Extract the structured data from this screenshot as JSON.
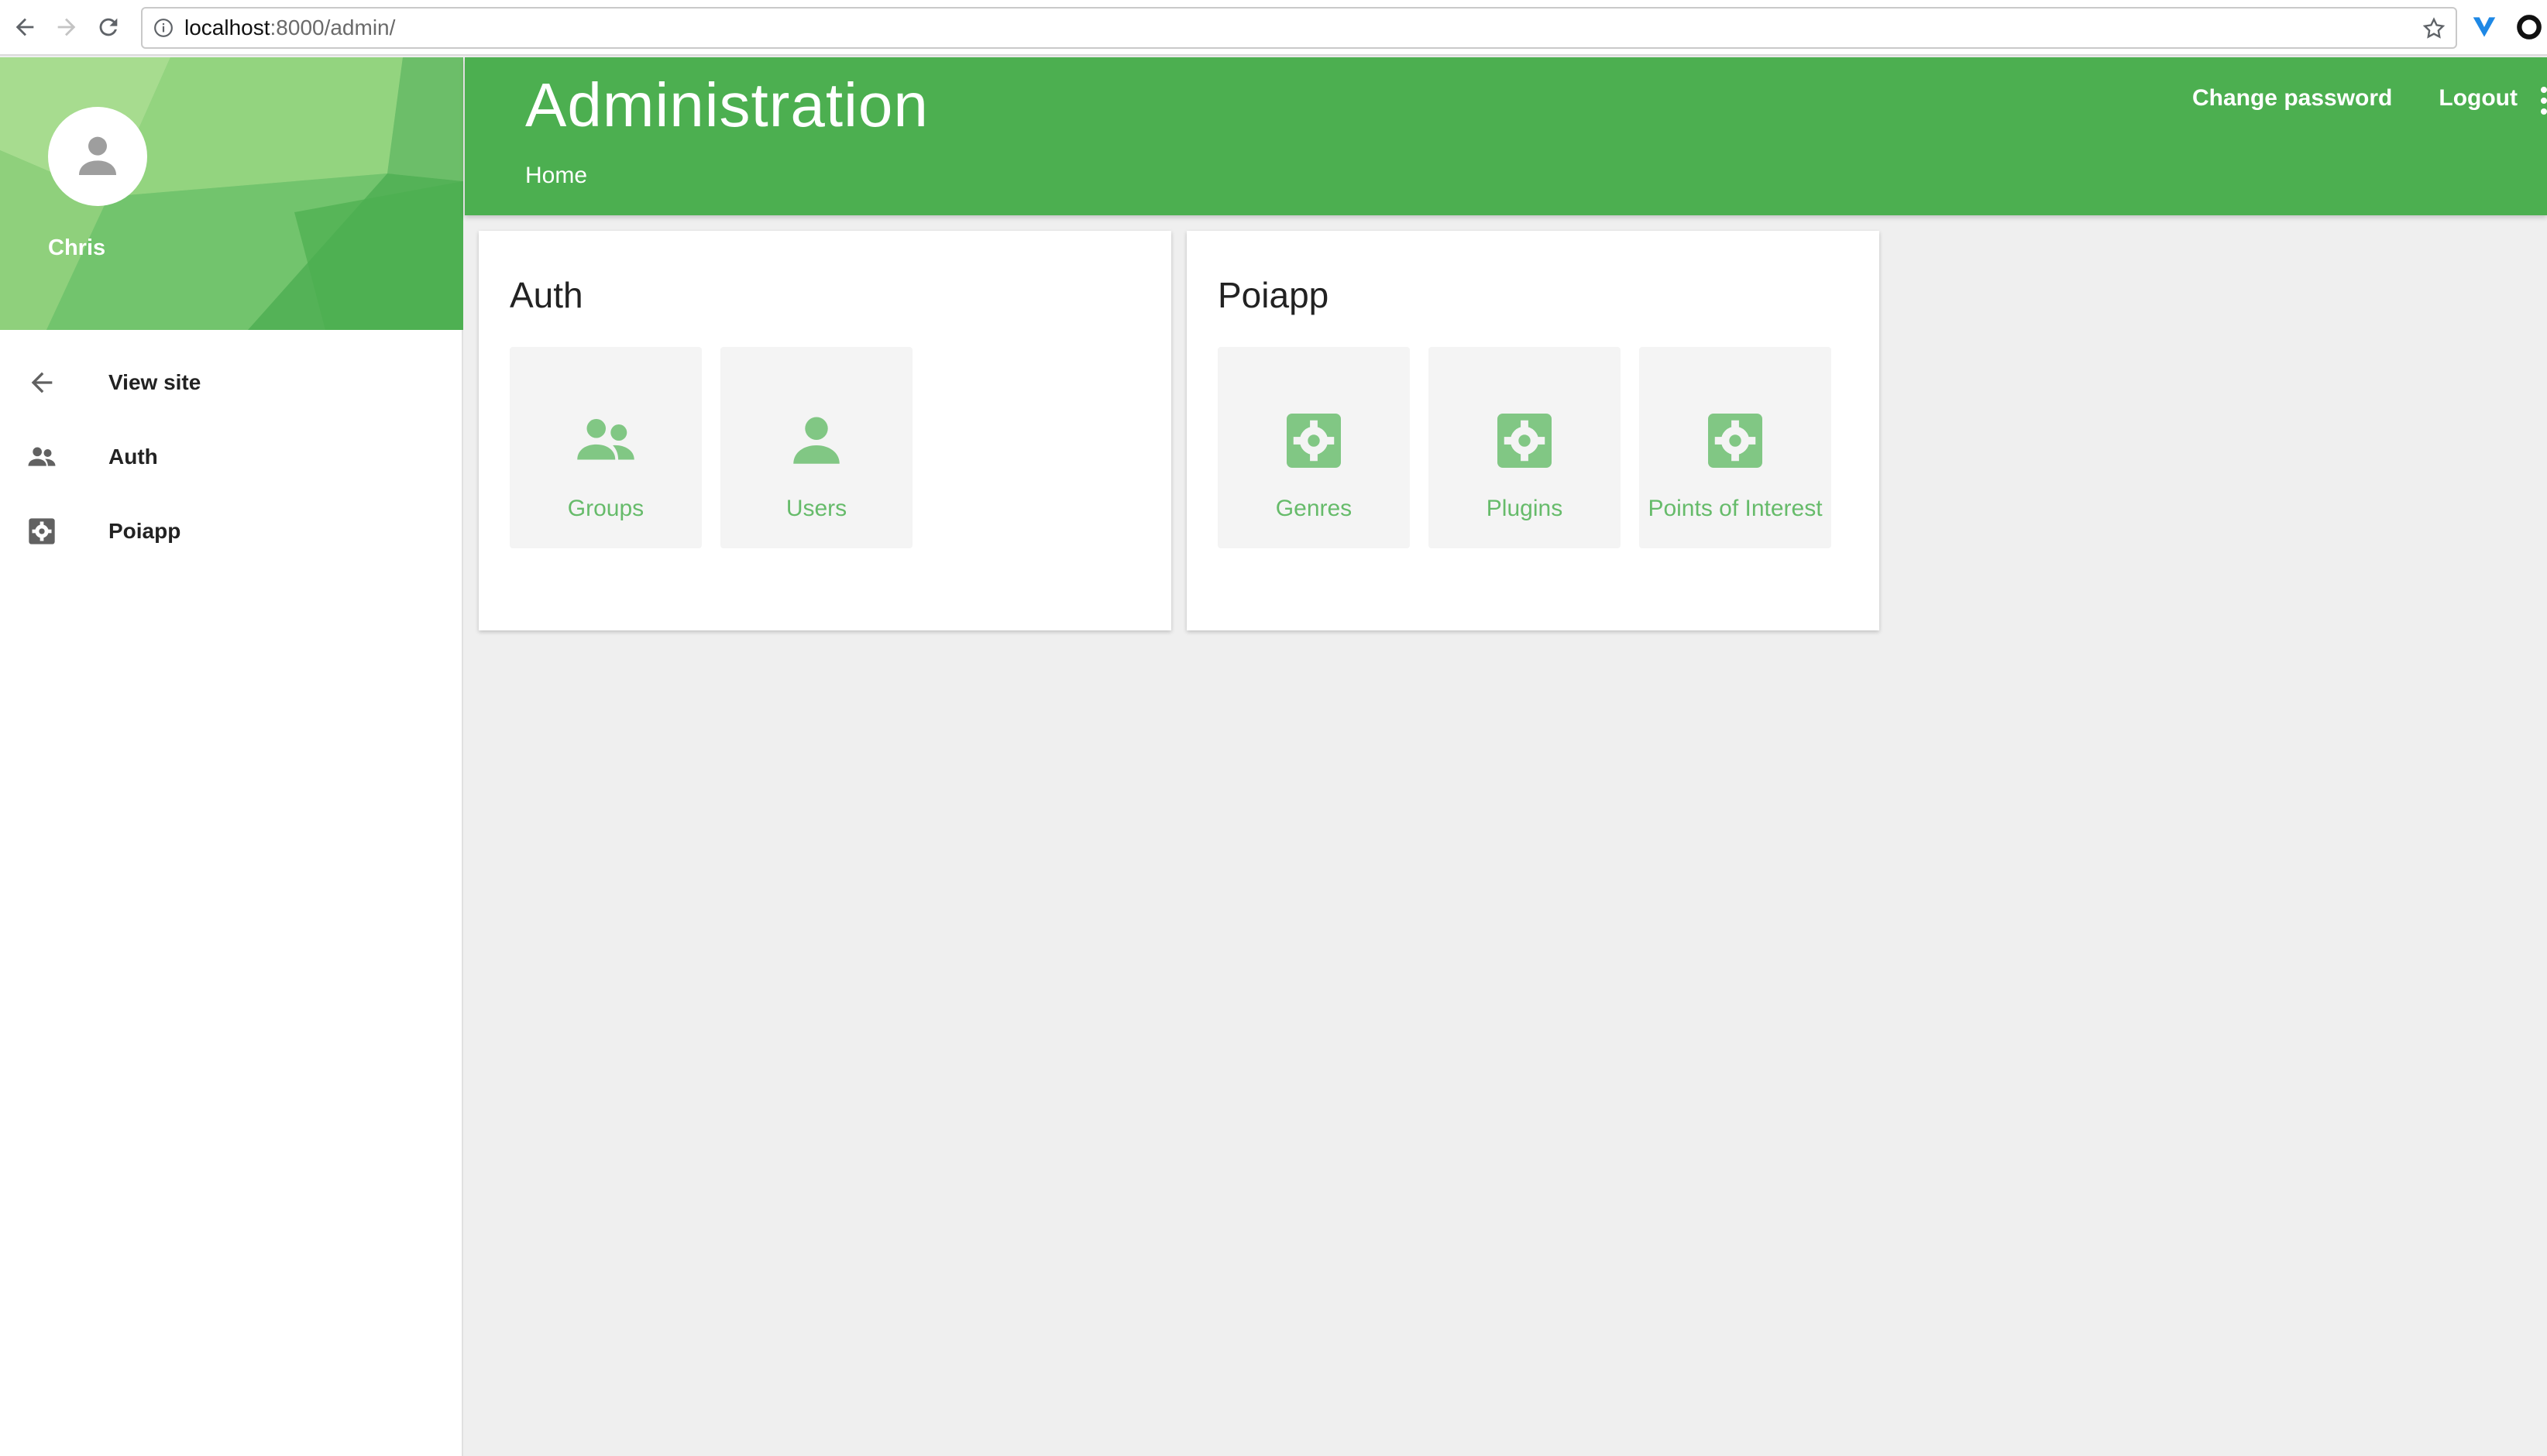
{
  "browser": {
    "url_host": "localhost",
    "url_path": ":8000/admin/"
  },
  "sidebar": {
    "user_name": "Chris",
    "items": [
      {
        "label": "View site",
        "icon": "arrow-left-icon"
      },
      {
        "label": "Auth",
        "icon": "people-icon"
      },
      {
        "label": "Poiapp",
        "icon": "gear-box-icon"
      }
    ]
  },
  "header": {
    "title": "Administration",
    "breadcrumb": "Home",
    "change_password": "Change password",
    "logout": "Logout"
  },
  "apps": [
    {
      "title": "Auth",
      "models": [
        {
          "label": "Groups",
          "icon": "group-icon"
        },
        {
          "label": "Users",
          "icon": "person-icon"
        }
      ]
    },
    {
      "title": "Poiapp",
      "models": [
        {
          "label": "Genres",
          "icon": "gear-box-icon"
        },
        {
          "label": "Plugins",
          "icon": "gear-box-icon"
        },
        {
          "label": "Points of Interest",
          "icon": "gear-box-icon"
        }
      ]
    }
  ],
  "colors": {
    "primary": "#4caf50",
    "accent_text": "#66bb6a",
    "background": "#efefef"
  }
}
